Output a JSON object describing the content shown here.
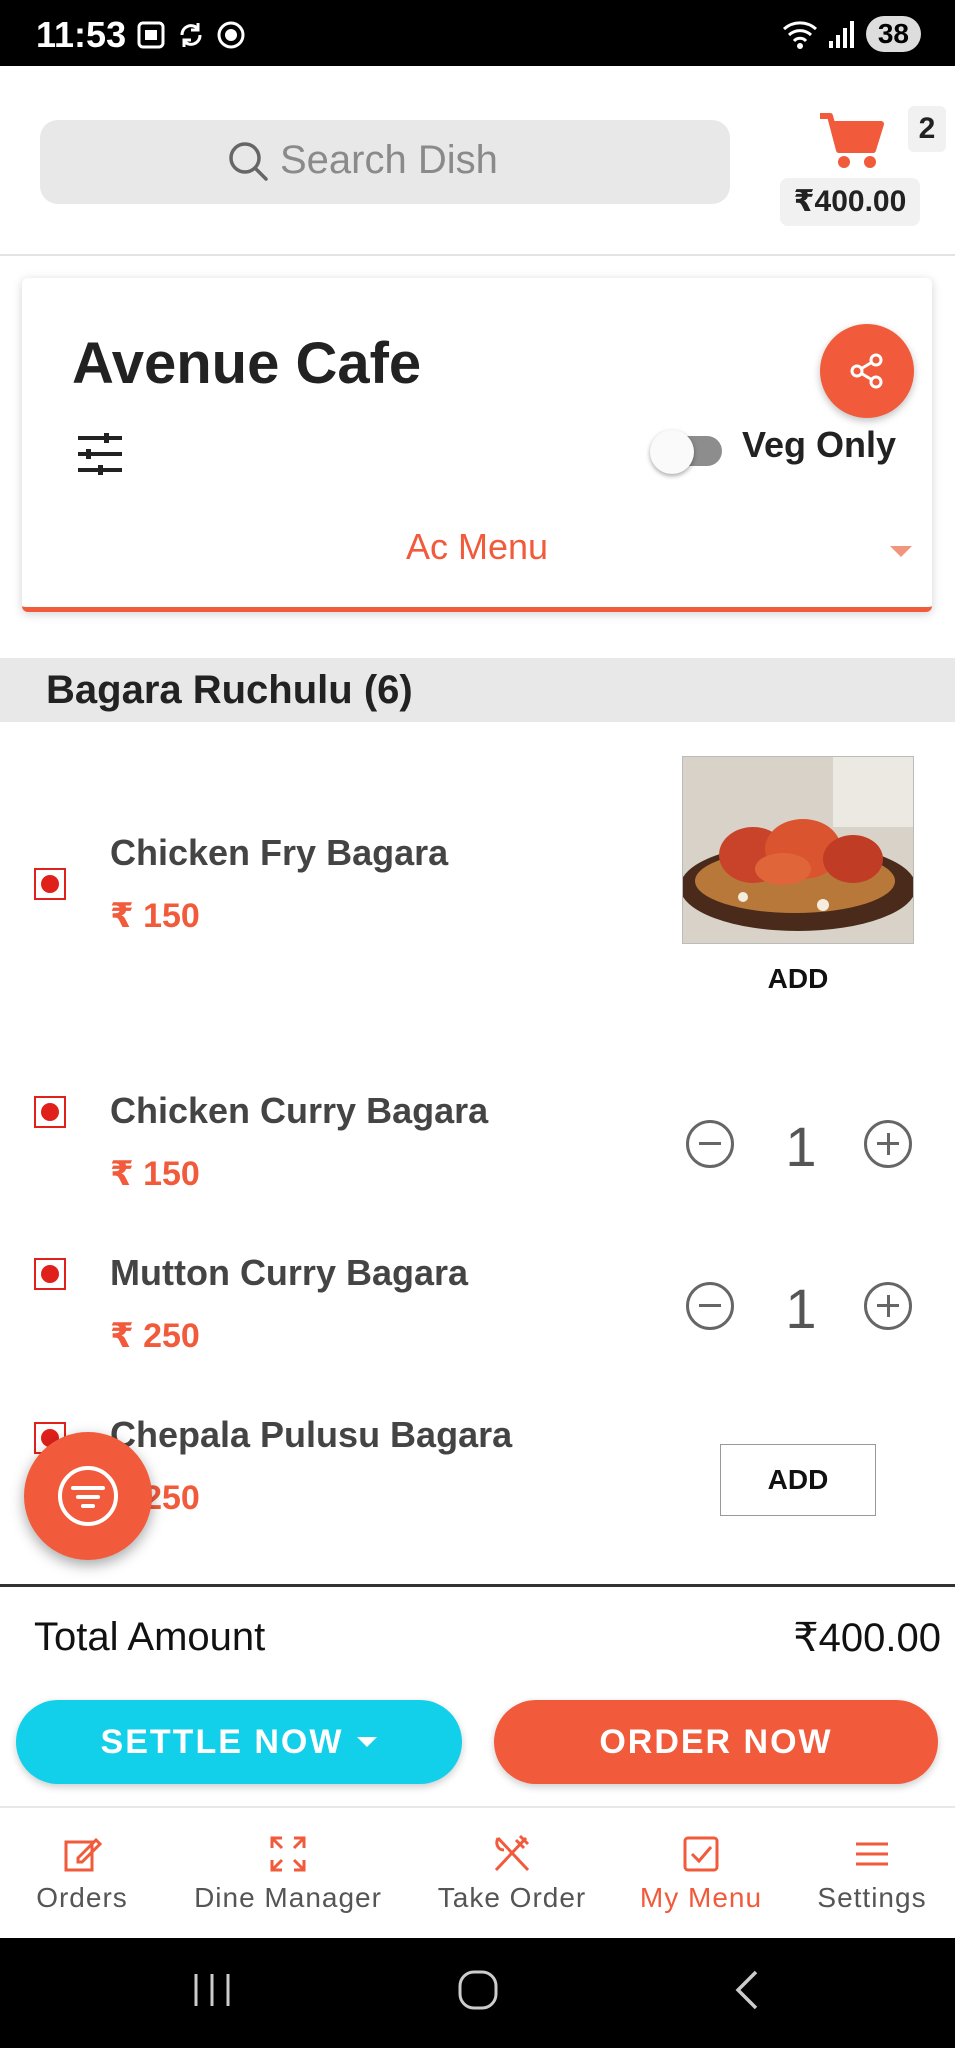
{
  "status_bar": {
    "time": "11:53",
    "battery": "38"
  },
  "header": {
    "search_placeholder": "Search Dish",
    "cart_count": "2",
    "cart_total": "₹400.00"
  },
  "restaurant": {
    "name": "Avenue Cafe",
    "veg_only_label": "Veg Only",
    "veg_only_enabled": false,
    "menu_selected": "Ac Menu"
  },
  "section": {
    "title": "Bagara Ruchulu (6)"
  },
  "dishes": [
    {
      "name": "Chicken Fry Bagara",
      "price": "₹ 150",
      "action": "ADD"
    },
    {
      "name": "Chicken Curry Bagara",
      "price": "₹ 150",
      "quantity": "1"
    },
    {
      "name": "Mutton Curry Bagara",
      "price": "₹ 250",
      "quantity": "1"
    },
    {
      "name": "Chepala Pulusu Bagara",
      "price": "₹ 250",
      "action": "ADD"
    }
  ],
  "summary": {
    "total_label": "Total Amount",
    "total_value": "₹400.00"
  },
  "actions": {
    "settle": "SETTLE NOW",
    "order": "ORDER NOW"
  },
  "bottom_nav": [
    {
      "label": "Orders",
      "icon": "edit-icon"
    },
    {
      "label": "Dine Manager",
      "icon": "expand-icon"
    },
    {
      "label": "Take Order",
      "icon": "utensils-icon"
    },
    {
      "label": "My Menu",
      "icon": "checkbox-icon",
      "active": true
    },
    {
      "label": "Settings",
      "icon": "menu-lines-icon"
    }
  ],
  "colors": {
    "accent": "#f15a3a",
    "settle": "#12d0e9",
    "veg_mark": "#e0201b"
  }
}
